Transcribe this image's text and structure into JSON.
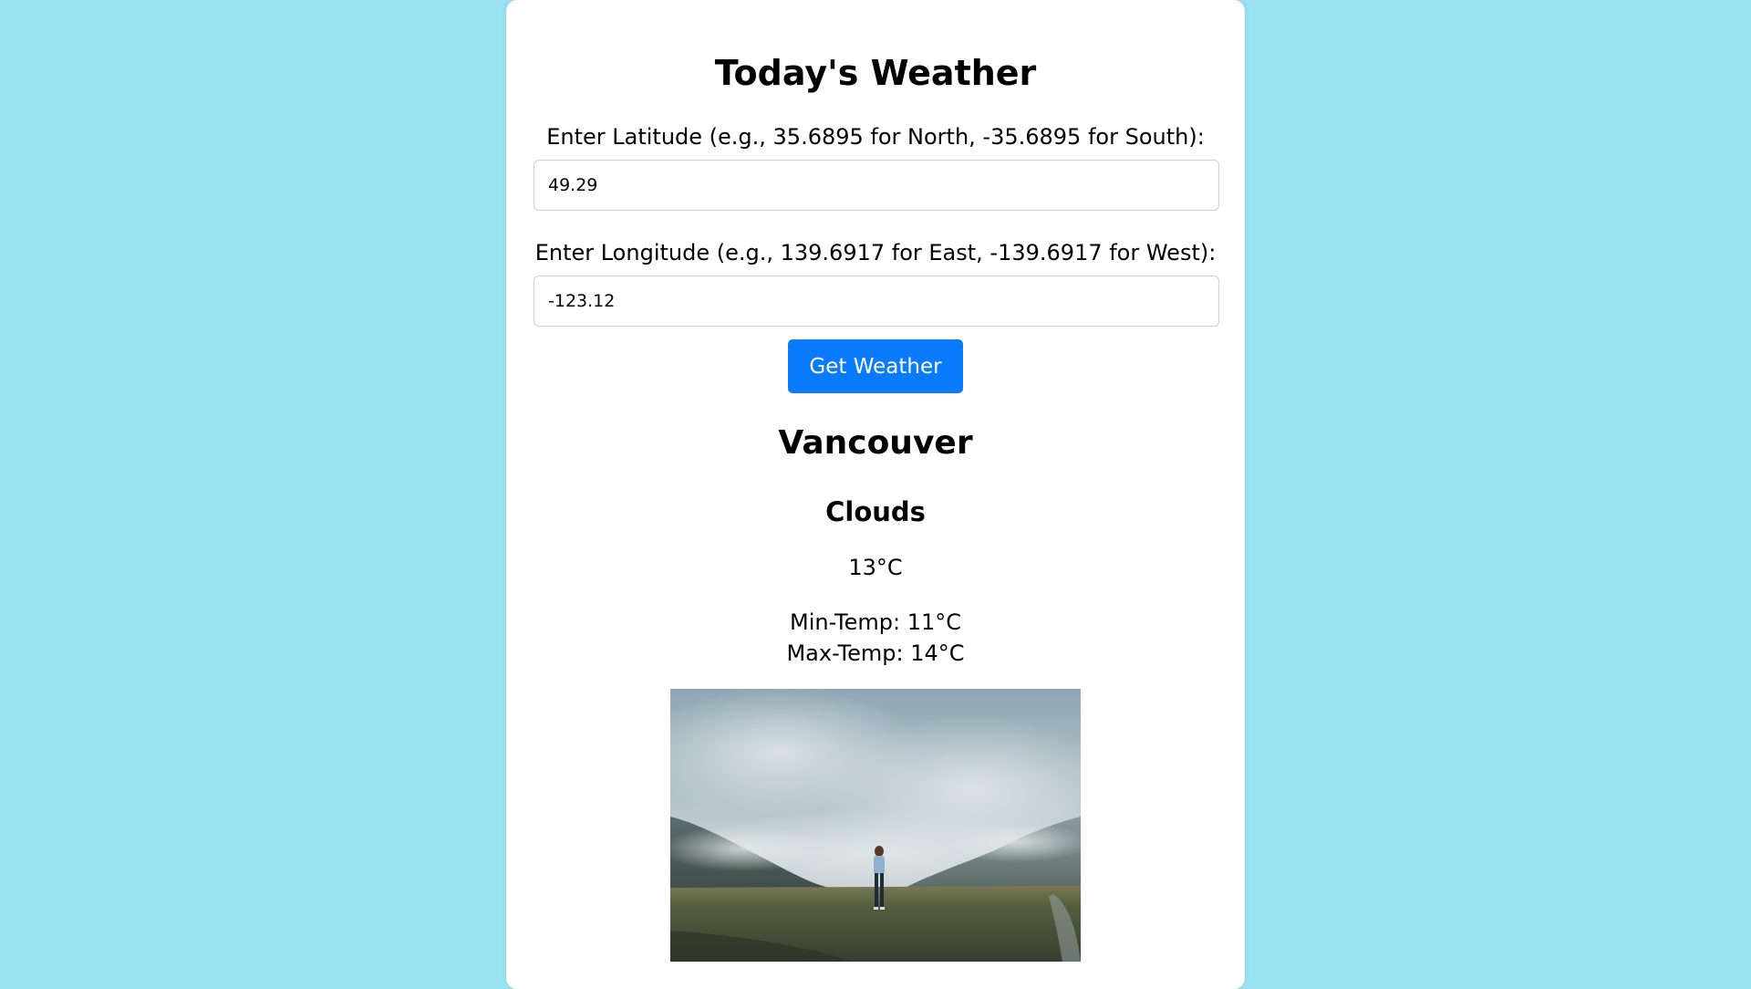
{
  "app": {
    "title": "Today's Weather"
  },
  "form": {
    "latitude_label": "Enter Latitude (e.g., 35.6895 for North, -35.6895 for South):",
    "latitude_value": "49.29",
    "longitude_label": "Enter Longitude (e.g., 139.6917 for East, -139.6917 for West):",
    "longitude_value": "-123.12",
    "submit_label": "Get Weather"
  },
  "result": {
    "city": "Vancouver",
    "condition": "Clouds",
    "temperature": "13°C",
    "min_temp": "Min-Temp: 11°C",
    "max_temp": "Max-Temp: 14°C",
    "image_subject": "person standing in grassy valley under cloudy mountains"
  },
  "colors": {
    "background": "#98e2f2",
    "card": "#ffffff",
    "button": "#0a7bff",
    "button_text": "#ffffff"
  }
}
